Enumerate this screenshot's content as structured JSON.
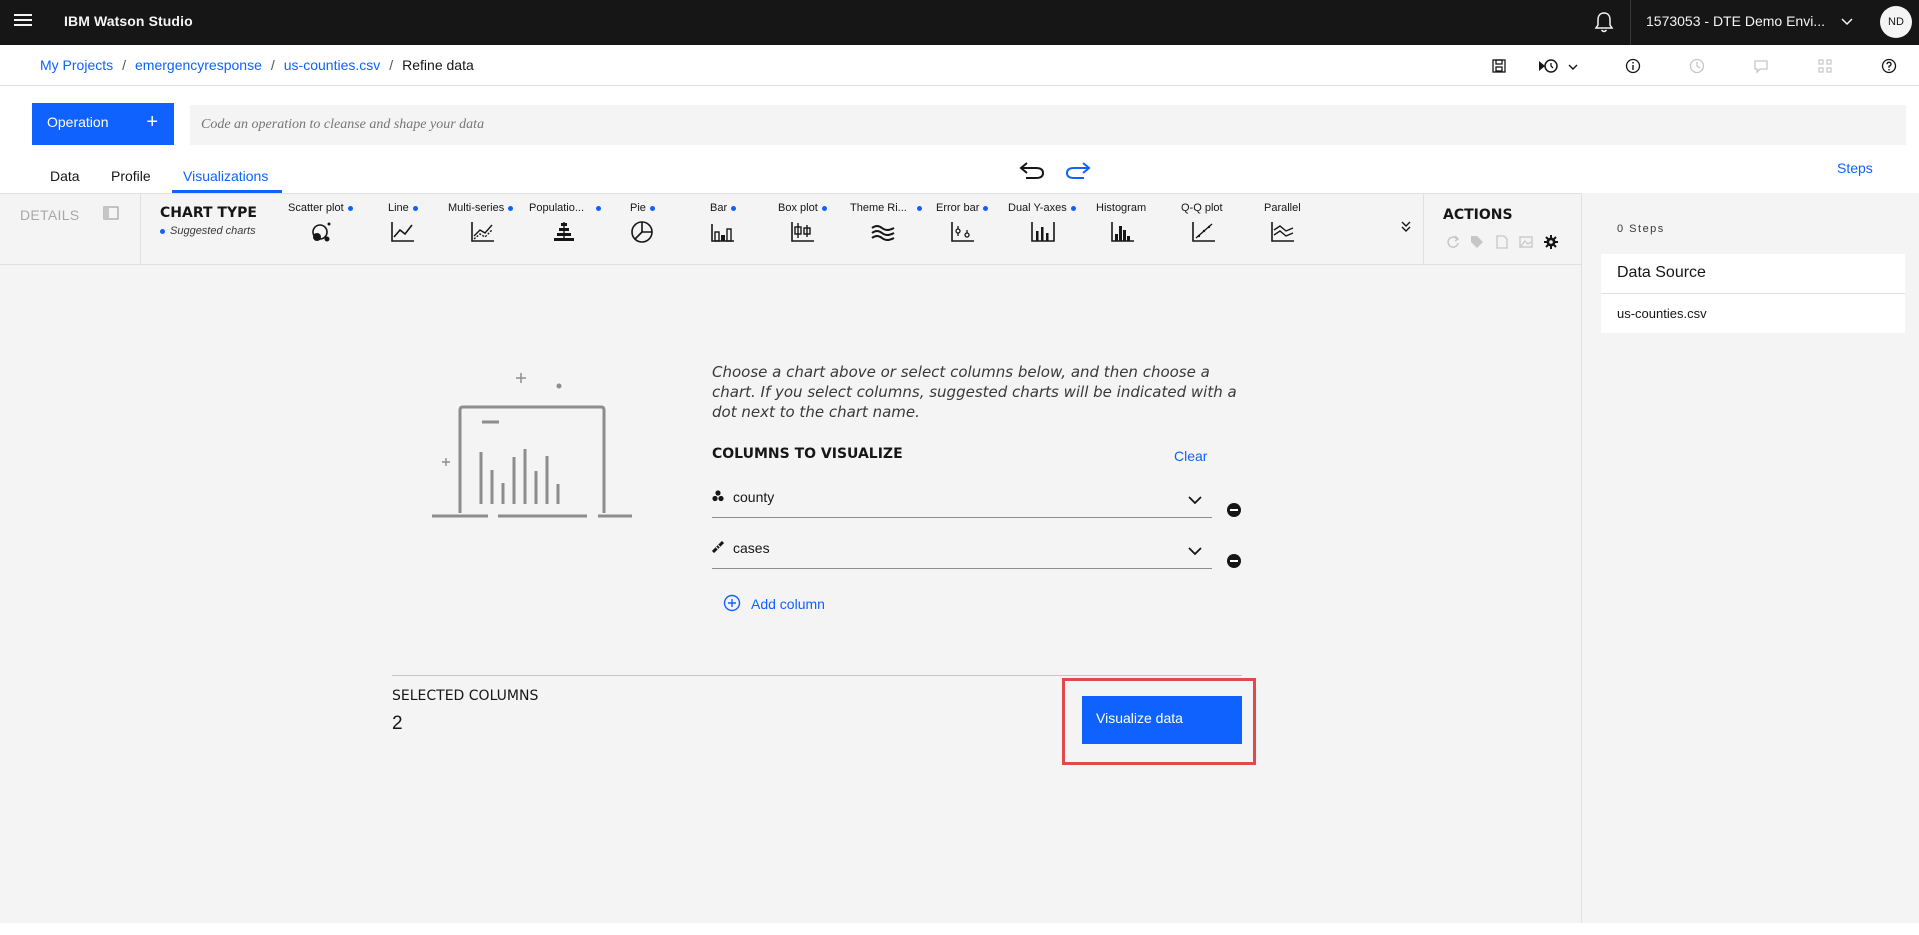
{
  "header": {
    "brand": "IBM Watson Studio",
    "account": "1573053 - DTE Demo Envi...",
    "avatar_initials": "ND"
  },
  "breadcrumb": {
    "items": [
      "My Projects",
      "emergencyresponse",
      "us-counties.csv"
    ],
    "current": "Refine data"
  },
  "operation": {
    "button_label": "Operation",
    "placeholder": "Code an operation to cleanse and shape your data"
  },
  "tabs": [
    "Data",
    "Profile",
    "Visualizations"
  ],
  "active_tab": "Visualizations",
  "steps_link": "Steps",
  "chart_panel": {
    "details_label": "DETAILS",
    "chart_type_title": "CHART TYPE",
    "suggested_label": "Suggested charts",
    "charts": [
      {
        "label": "Scatter plot",
        "suggested": true,
        "icon": "scatter-icon"
      },
      {
        "label": "Line",
        "suggested": true,
        "icon": "line-chart-icon"
      },
      {
        "label": "Multi-series",
        "suggested": true,
        "icon": "multi-series-icon"
      },
      {
        "label": "Populatio...",
        "suggested": true,
        "icon": "population-pyramid-icon"
      },
      {
        "label": "Pie",
        "suggested": true,
        "icon": "pie-chart-icon"
      },
      {
        "label": "Bar",
        "suggested": true,
        "icon": "bar-chart-icon"
      },
      {
        "label": "Box plot",
        "suggested": true,
        "icon": "box-plot-icon"
      },
      {
        "label": "Theme Ri...",
        "suggested": true,
        "icon": "theme-river-icon"
      },
      {
        "label": "Error bar",
        "suggested": true,
        "icon": "error-bar-icon"
      },
      {
        "label": "Dual Y-axes",
        "suggested": true,
        "icon": "dual-y-axes-icon"
      },
      {
        "label": "Histogram",
        "suggested": false,
        "icon": "histogram-icon"
      },
      {
        "label": "Q-Q plot",
        "suggested": false,
        "icon": "qq-plot-icon"
      },
      {
        "label": "Parallel",
        "suggested": false,
        "icon": "parallel-icon"
      }
    ],
    "actions_title": "ACTIONS"
  },
  "visualize": {
    "instructions": "Choose a chart above or select columns below, and then choose a chart. If you select columns, suggested charts will be indicated with a dot next to the chart name.",
    "columns_title": "COLUMNS TO VISUALIZE",
    "clear_label": "Clear",
    "columns": [
      {
        "name": "county",
        "icon": "categorical-icon"
      },
      {
        "name": "cases",
        "icon": "numeric-ruler-icon"
      }
    ],
    "add_column_label": "Add column",
    "selected_title": "SELECTED COLUMNS",
    "selected_count": "2",
    "visualize_button": "Visualize data"
  },
  "right_panel": {
    "steps_count": "0 Steps",
    "data_source_title": "Data Source",
    "data_source_item": "us-counties.csv"
  },
  "colors": {
    "accent": "#0f62fe",
    "header_bg": "#161616",
    "highlight_border": "#e04a48",
    "panel_bg": "#f4f4f4"
  }
}
